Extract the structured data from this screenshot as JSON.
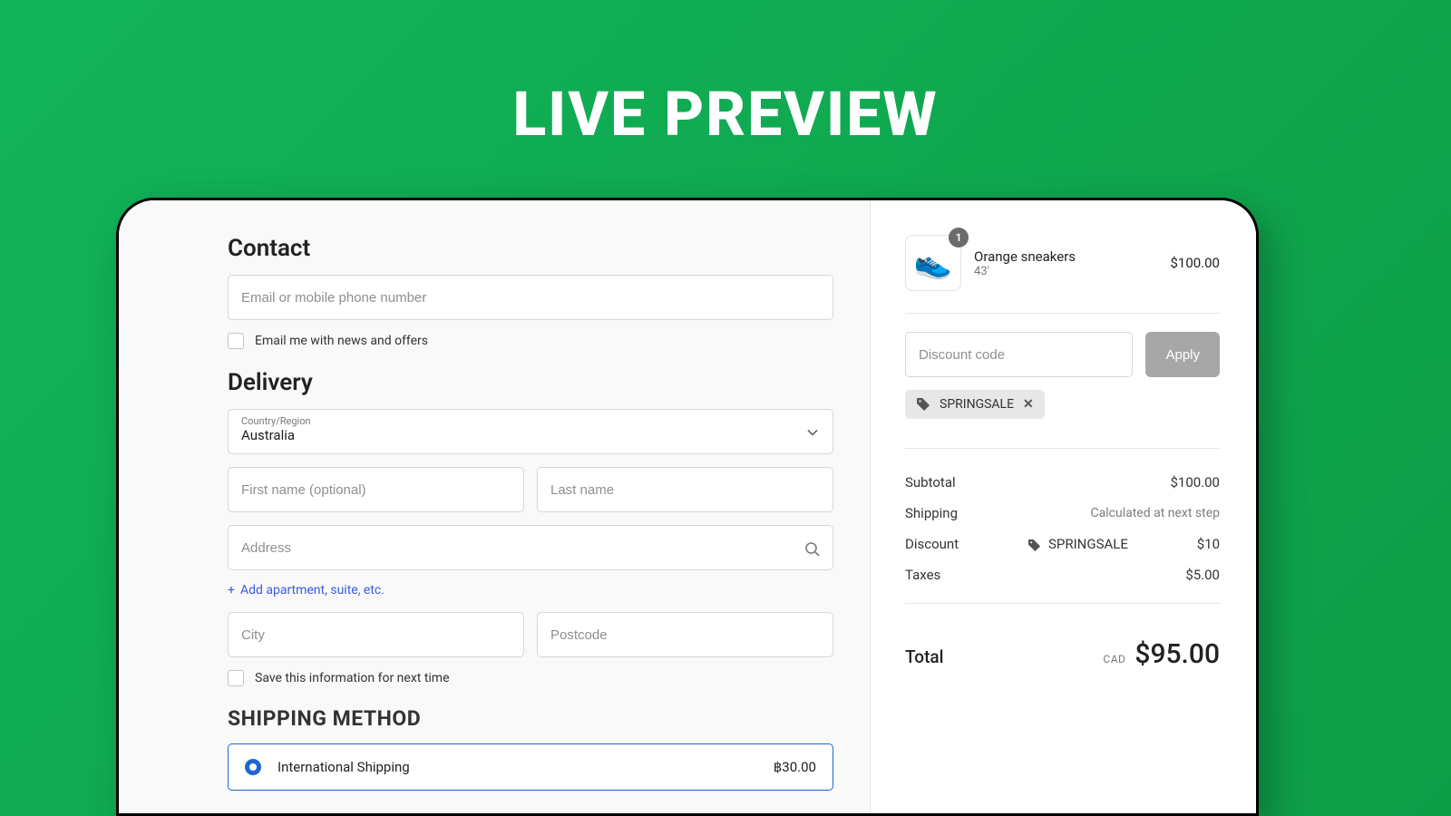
{
  "hero_title": "LIVE PREVIEW",
  "contact": {
    "heading": "Contact",
    "email_placeholder": "Email or mobile phone number",
    "news_label": "Email me with news and offers"
  },
  "delivery": {
    "heading": "Delivery",
    "country_label": "Country/Region",
    "country_value": "Australia",
    "first_name_placeholder": "First name (optional)",
    "last_name_placeholder": "Last name",
    "address_placeholder": "Address",
    "add_apartment_label": "Add apartment, suite, etc.",
    "city_placeholder": "City",
    "postcode_placeholder": "Postcode",
    "save_info_label": "Save this information for next time"
  },
  "shipping": {
    "heading": "SHIPPING METHOD",
    "option_name": "International Shipping",
    "option_price": "฿30.00"
  },
  "cart": {
    "item_name": "Orange sneakers",
    "item_variant": "43'",
    "item_price": "$100.00",
    "item_qty": "1",
    "discount_placeholder": "Discount code",
    "apply_label": "Apply",
    "applied_code": "SPRINGSALE"
  },
  "summary": {
    "subtotal_label": "Subtotal",
    "subtotal_value": "$100.00",
    "shipping_label": "Shipping",
    "shipping_value": "Calculated at next step",
    "discount_label": "Discount",
    "discount_code": "SPRINGSALE",
    "discount_value": "$10",
    "taxes_label": "Taxes",
    "taxes_value": "$5.00",
    "total_label": "Total",
    "currency": "CAD",
    "total_value": "$95.00"
  }
}
